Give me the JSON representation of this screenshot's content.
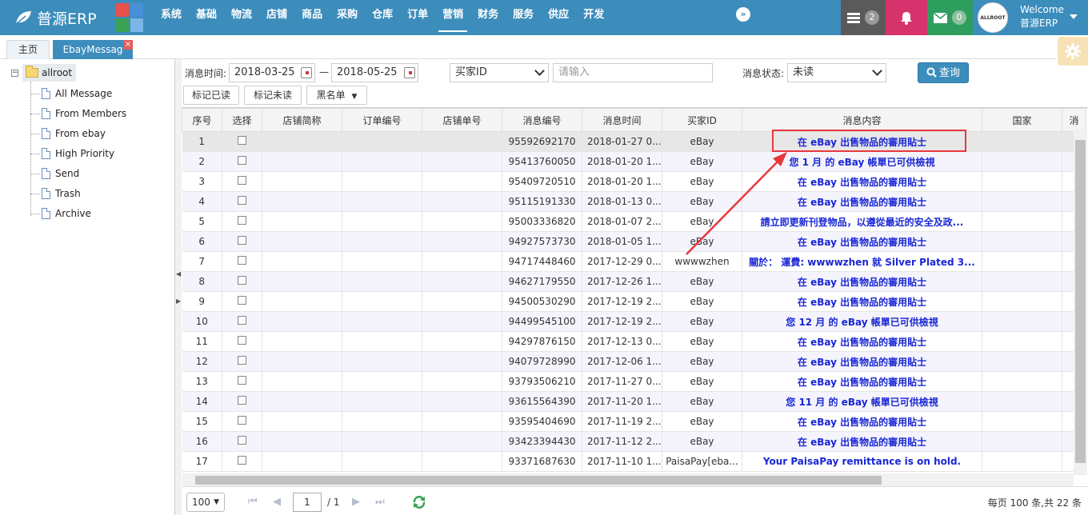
{
  "app": {
    "logo_text": "普源ERP"
  },
  "nav": {
    "items": [
      "系统",
      "基础",
      "物流",
      "店铺",
      "商品",
      "采购",
      "仓库",
      "订单",
      "营销",
      "财务",
      "服务",
      "供应",
      "开发"
    ],
    "active": "营销",
    "more_label": "»"
  },
  "header": {
    "list_badge": "2",
    "mail_badge": "0",
    "welcome": "Welcome",
    "user": "普源ERP",
    "avatar_text": "ALLROOT"
  },
  "tabs": {
    "home": "主页",
    "active": "EbayMessag",
    "close": "×"
  },
  "tree": {
    "toggle": "−",
    "root": "allroot",
    "items": [
      "All Message",
      "From Members",
      "From ebay",
      "High Priority",
      "Send",
      "Trash",
      "Archive"
    ]
  },
  "filters": {
    "time_label": "消息时间:",
    "date_from": "2018-03-25",
    "date_sep": "—",
    "date_to": "2018-05-25",
    "buyer_select": "买家ID",
    "search_placeholder": "请输入",
    "status_label": "消息状态:",
    "status_value": "未读",
    "search_button": "查询"
  },
  "actions": {
    "mark_read": "标记已读",
    "mark_unread": "标记未读",
    "blacklist": "黑名单"
  },
  "table": {
    "headers": [
      "序号",
      "选择",
      "店铺简称",
      "订单编号",
      "店铺单号",
      "消息编号",
      "消息时间",
      "买家ID",
      "消息内容",
      "国家",
      "消"
    ],
    "rows": [
      {
        "no": "1",
        "store": "",
        "order": "",
        "store_no": "",
        "msg_id": "95592692170",
        "time": "2018-01-27 0...",
        "buyer": "eBay",
        "content": "在 eBay 出售物品的審用貼士"
      },
      {
        "no": "2",
        "store": "",
        "order": "",
        "store_no": "",
        "msg_id": "95413760050",
        "time": "2018-01-20 1...",
        "buyer": "eBay",
        "content": "您 1 月 的 eBay 帳單已可供檢視"
      },
      {
        "no": "3",
        "store": "",
        "order": "",
        "store_no": "",
        "msg_id": "95409720510",
        "time": "2018-01-20 1...",
        "buyer": "eBay",
        "content": "在 eBay 出售物品的審用貼士"
      },
      {
        "no": "4",
        "store": "",
        "order": "",
        "store_no": "",
        "msg_id": "95115191330",
        "time": "2018-01-13 0...",
        "buyer": "eBay",
        "content": "在 eBay 出售物品的審用貼士"
      },
      {
        "no": "5",
        "store": "",
        "order": "",
        "store_no": "",
        "msg_id": "95003336820",
        "time": "2018-01-07 2...",
        "buyer": "eBay",
        "content": "請立即更新刊登物品，以遵從最近的安全及政..."
      },
      {
        "no": "6",
        "store": "",
        "order": "",
        "store_no": "",
        "msg_id": "94927573730",
        "time": "2018-01-05 1...",
        "buyer": "eBay",
        "content": "在 eBay 出售物品的審用貼士"
      },
      {
        "no": "7",
        "store": "",
        "order": "",
        "store_no": "",
        "msg_id": "94717448460",
        "time": "2017-12-29 0...",
        "buyer": "wwwwzhen",
        "content": "關於： 運費: wwwwzhen 就 Silver Plated 3..."
      },
      {
        "no": "8",
        "store": "",
        "order": "",
        "store_no": "",
        "msg_id": "94627179550",
        "time": "2017-12-26 1...",
        "buyer": "eBay",
        "content": "在 eBay 出售物品的審用貼士"
      },
      {
        "no": "9",
        "store": "",
        "order": "",
        "store_no": "",
        "msg_id": "94500530290",
        "time": "2017-12-19 2...",
        "buyer": "eBay",
        "content": "在 eBay 出售物品的審用貼士"
      },
      {
        "no": "10",
        "store": "",
        "order": "",
        "store_no": "",
        "msg_id": "94499545100",
        "time": "2017-12-19 2...",
        "buyer": "eBay",
        "content": "您 12 月 的 eBay 帳單已可供檢視"
      },
      {
        "no": "11",
        "store": "",
        "order": "",
        "store_no": "",
        "msg_id": "94297876150",
        "time": "2017-12-13 0...",
        "buyer": "eBay",
        "content": "在 eBay 出售物品的審用貼士"
      },
      {
        "no": "12",
        "store": "",
        "order": "",
        "store_no": "",
        "msg_id": "94079728990",
        "time": "2017-12-06 1...",
        "buyer": "eBay",
        "content": "在 eBay 出售物品的審用貼士"
      },
      {
        "no": "13",
        "store": "",
        "order": "",
        "store_no": "",
        "msg_id": "93793506210",
        "time": "2017-11-27 0...",
        "buyer": "eBay",
        "content": "在 eBay 出售物品的審用貼士"
      },
      {
        "no": "14",
        "store": "",
        "order": "",
        "store_no": "",
        "msg_id": "93615564390",
        "time": "2017-11-20 1...",
        "buyer": "eBay",
        "content": "您 11 月 的 eBay 帳單已可供檢視"
      },
      {
        "no": "15",
        "store": "",
        "order": "",
        "store_no": "",
        "msg_id": "93595404690",
        "time": "2017-11-19 2...",
        "buyer": "eBay",
        "content": "在 eBay 出售物品的審用貼士"
      },
      {
        "no": "16",
        "store": "",
        "order": "",
        "store_no": "",
        "msg_id": "93423394430",
        "time": "2017-11-12 2...",
        "buyer": "eBay",
        "content": "在 eBay 出售物品的審用貼士"
      },
      {
        "no": "17",
        "store": "",
        "order": "",
        "store_no": "",
        "msg_id": "93371687630",
        "time": "2017-11-10 1...",
        "buyer": "PaisaPay[eba...",
        "content": "Your PaisaPay remittance is on hold."
      }
    ]
  },
  "pager": {
    "page_size": "100",
    "page": "1",
    "total_pages": "/ 1",
    "summary": "每页 100 条,共 22 条"
  },
  "colors": {
    "topbar": "#3c8dbc",
    "link_text": "#1a27d4",
    "highlight": "#e8383d",
    "notify": "#d6336c",
    "mail": "#2e9e5e"
  }
}
